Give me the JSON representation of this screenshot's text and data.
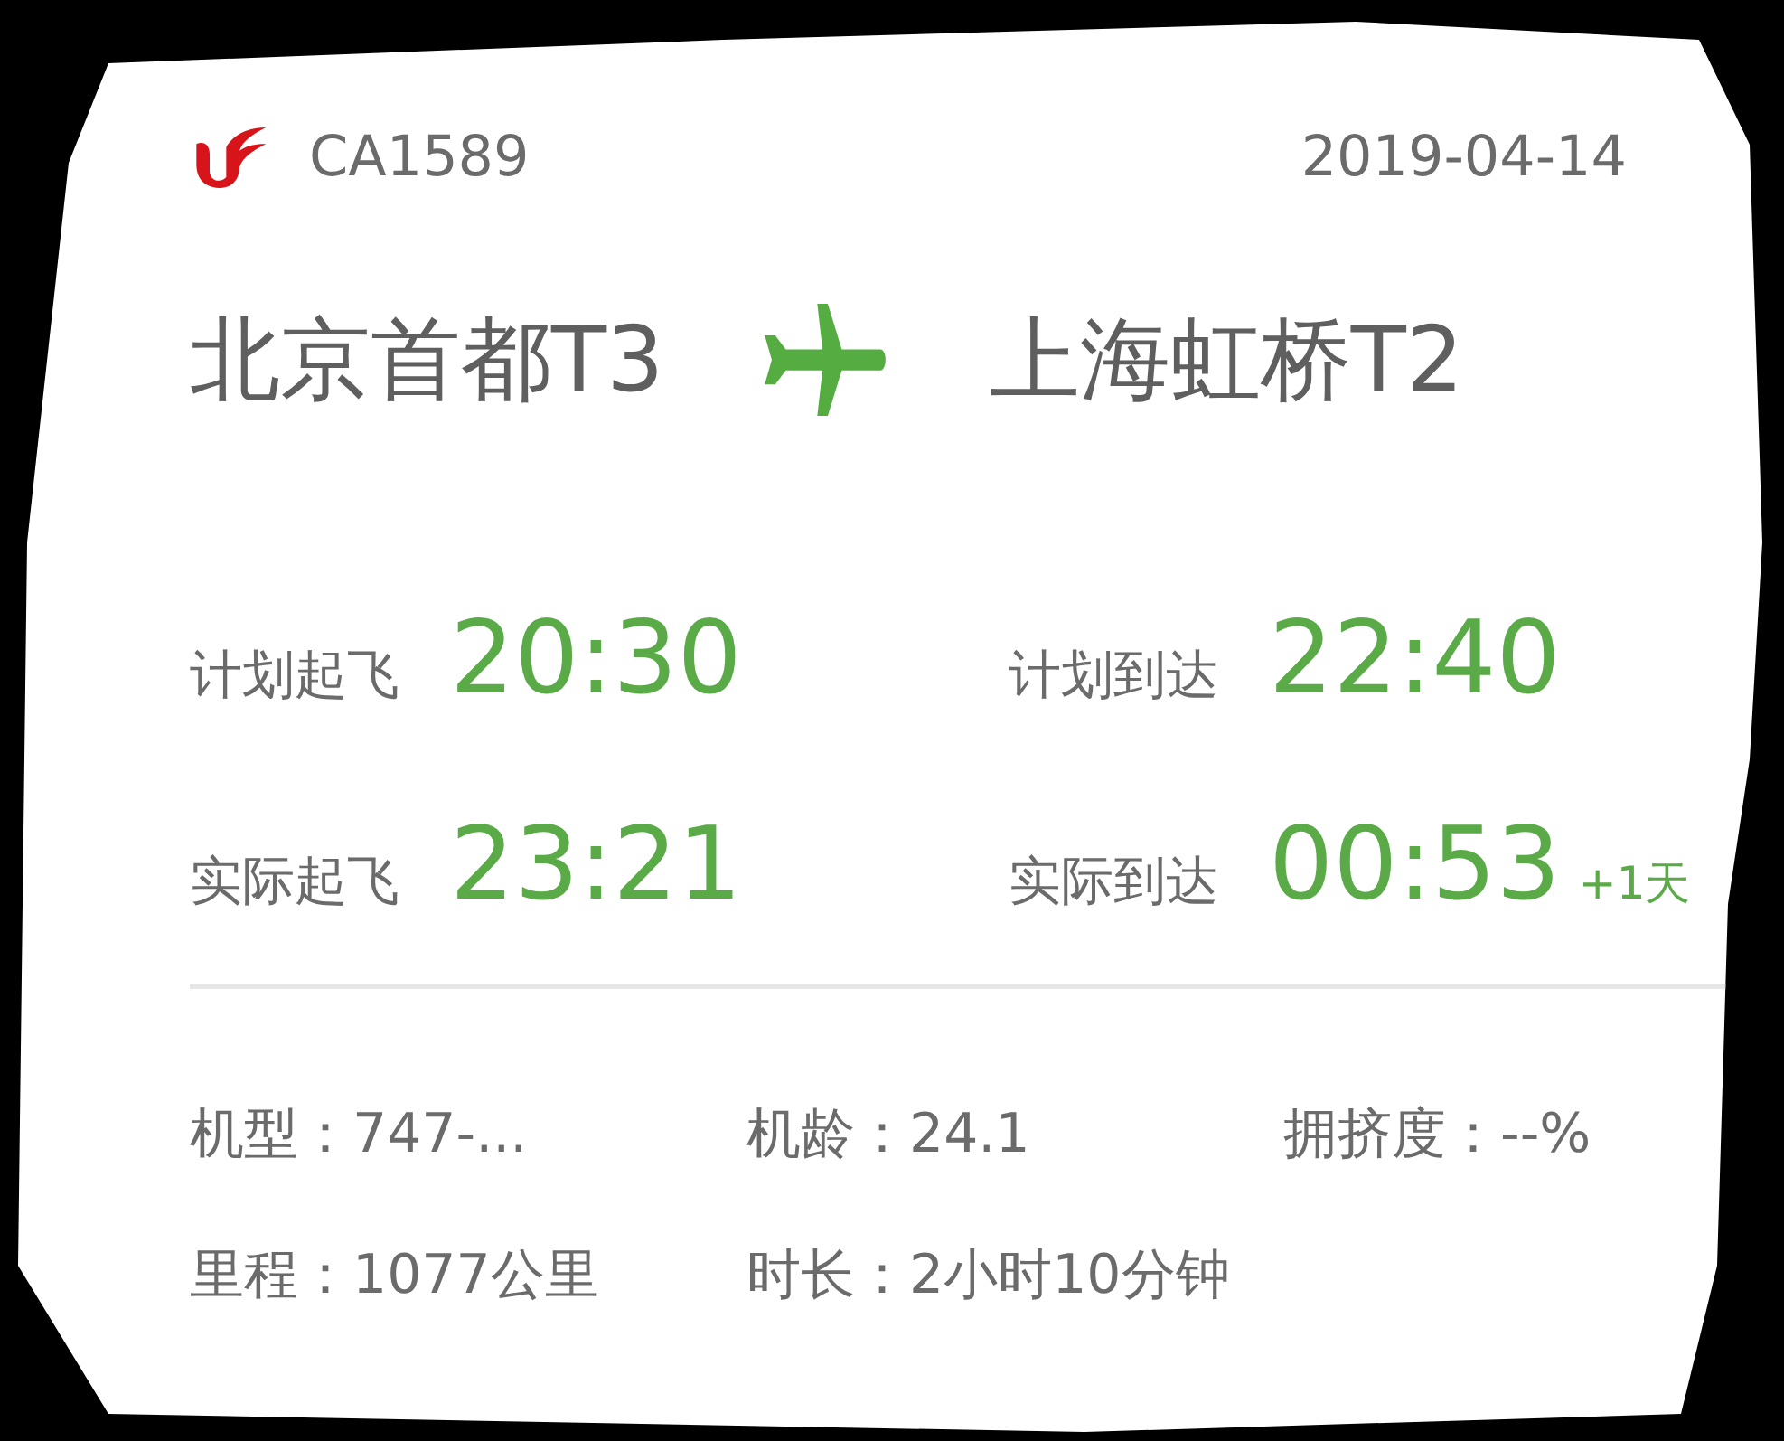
{
  "flight": {
    "number": "CA1589",
    "date": "2019-04-14"
  },
  "route": {
    "origin": "北京首都T3",
    "destination": "上海虹桥T2"
  },
  "times": [
    {
      "label": "计划起飞",
      "time": "20:30"
    },
    {
      "label": "计划到达",
      "time": "22:40"
    },
    {
      "label": "实际起飞",
      "time": "23:21"
    },
    {
      "label": "实际到达",
      "time": "00:53",
      "day_offset": "+1天"
    }
  ],
  "details": [
    {
      "text": "机型：747-..."
    },
    {
      "text": "机龄：24.1"
    },
    {
      "text": "拥挤度：--%"
    },
    {
      "text": "里程：1077公里"
    },
    {
      "text": "时长：2小时10分钟"
    }
  ]
}
